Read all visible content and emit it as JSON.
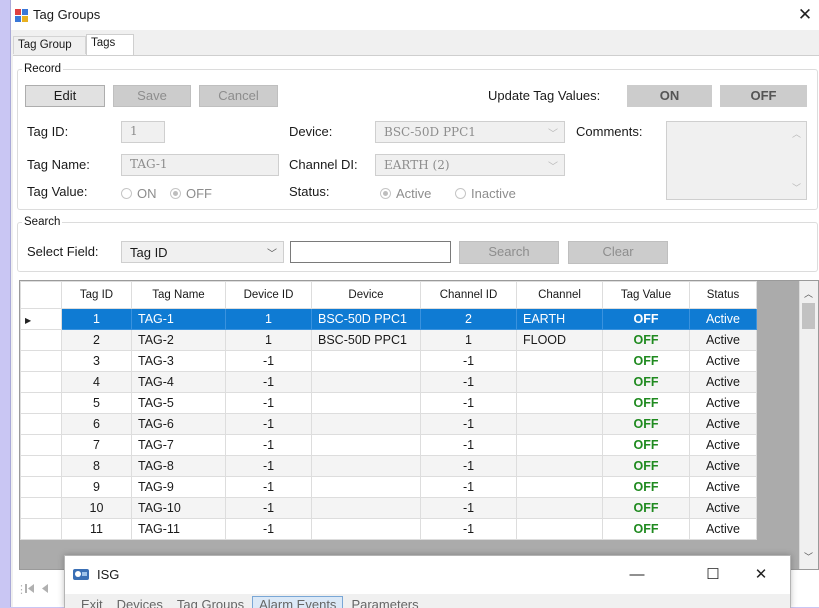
{
  "window": {
    "title": "Tag Groups",
    "close_label": "✕"
  },
  "tabs": [
    {
      "label": "Tag Group",
      "active": false
    },
    {
      "label": "Tags",
      "active": true
    }
  ],
  "record": {
    "legend": "Record",
    "buttons": {
      "edit": "Edit",
      "save": "Save",
      "cancel": "Cancel"
    },
    "update_label": "Update Tag Values:",
    "on_label": "ON",
    "off_label": "OFF"
  },
  "form": {
    "tag_id_label": "Tag ID:",
    "tag_id_value": "1",
    "tag_name_label": "Tag Name:",
    "tag_name_value": "TAG-1",
    "tag_value_label": "Tag Value:",
    "tag_value_on": "ON",
    "tag_value_off": "OFF",
    "tag_value_selected": "OFF",
    "device_label": "Device:",
    "device_value": "BSC-50D PPC1",
    "channel_label": "Channel DI:",
    "channel_value": "EARTH (2)",
    "status_label": "Status:",
    "status_active": "Active",
    "status_inactive": "Inactive",
    "status_selected": "Active",
    "comments_label": "Comments:"
  },
  "search": {
    "legend": "Search",
    "field_label": "Select Field:",
    "field_value": "Tag ID",
    "input_value": "",
    "search_label": "Search",
    "clear_label": "Clear"
  },
  "grid": {
    "columns": [
      "Tag ID",
      "Tag Name",
      "Device ID",
      "Device",
      "Channel ID",
      "Channel",
      "Tag Value",
      "Status"
    ],
    "rows": [
      [
        "1",
        "TAG-1",
        "1",
        "BSC-50D PPC1",
        "2",
        "EARTH",
        "OFF",
        "Active"
      ],
      [
        "2",
        "TAG-2",
        "1",
        "BSC-50D PPC1",
        "1",
        "FLOOD",
        "OFF",
        "Active"
      ],
      [
        "3",
        "TAG-3",
        "-1",
        "",
        "-1",
        "",
        "OFF",
        "Active"
      ],
      [
        "4",
        "TAG-4",
        "-1",
        "",
        "-1",
        "",
        "OFF",
        "Active"
      ],
      [
        "5",
        "TAG-5",
        "-1",
        "",
        "-1",
        "",
        "OFF",
        "Active"
      ],
      [
        "6",
        "TAG-6",
        "-1",
        "",
        "-1",
        "",
        "OFF",
        "Active"
      ],
      [
        "7",
        "TAG-7",
        "-1",
        "",
        "-1",
        "",
        "OFF",
        "Active"
      ],
      [
        "8",
        "TAG-8",
        "-1",
        "",
        "-1",
        "",
        "OFF",
        "Active"
      ],
      [
        "9",
        "TAG-9",
        "-1",
        "",
        "-1",
        "",
        "OFF",
        "Active"
      ],
      [
        "10",
        "TAG-10",
        "-1",
        "",
        "-1",
        "",
        "OFF",
        "Active"
      ],
      [
        "11",
        "TAG-11",
        "-1",
        "",
        "-1",
        "",
        "OFF",
        "Active"
      ]
    ],
    "selected_index": 0
  },
  "isg_window": {
    "title": "ISG",
    "minimize": "—",
    "maximize": "☐",
    "close": "✕",
    "menu": [
      "Exit",
      "Devices",
      "Tag Groups",
      "Alarm Events",
      "Parameters"
    ]
  },
  "colors": {
    "selection": "#0f7bd3",
    "off_value": "#1f8a1f",
    "desktop": "#c9c6f3"
  }
}
